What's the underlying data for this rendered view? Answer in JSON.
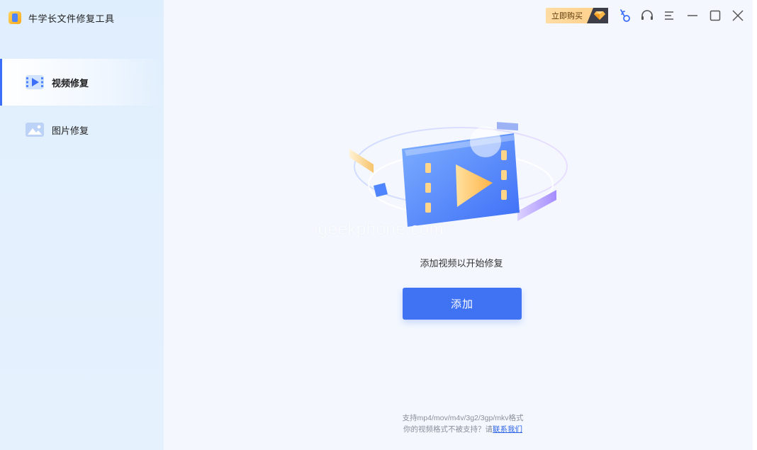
{
  "app": {
    "title": "牛学长文件修复工具",
    "logo_icon": "app-logo-icon"
  },
  "sidebar": {
    "items": [
      {
        "label": "视频修复",
        "icon": "video-icon",
        "active": true
      },
      {
        "label": "图片修复",
        "icon": "image-icon",
        "active": false
      }
    ]
  },
  "topbar": {
    "buy_label": "立即购买",
    "icons": [
      "vip-diamond-icon",
      "key-icon",
      "headset-icon",
      "menu-icon",
      "minimize-icon",
      "maximize-icon",
      "close-icon"
    ]
  },
  "main": {
    "watermark": "igeekphone.com",
    "prompt": "添加视频以开始修复",
    "add_button": "添加",
    "support_formats": "支持mp4/mov/m4v/3g2/3gp/mkv格式",
    "unsupported_prefix": "你的视频格式不被支持？请",
    "contact_link": "联系我们"
  },
  "colors": {
    "accent": "#3f73f4",
    "sidebar_bg": "#e2effd",
    "main_bg": "#f4f8fe",
    "buy_bg": "#ffd491"
  }
}
